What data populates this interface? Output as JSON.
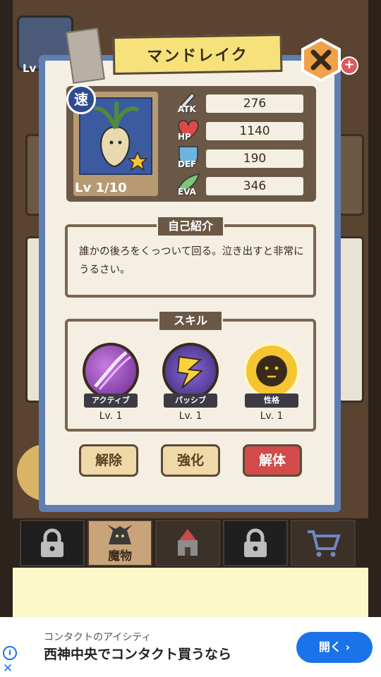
{
  "background": {
    "avatar_level": "Lv"
  },
  "dialog": {
    "title": "マンドレイク",
    "speed_badge": "速",
    "level": "Lv 1/10",
    "stats": [
      {
        "label": "ATK",
        "value": "276",
        "icon": "sword-icon"
      },
      {
        "label": "HP",
        "value": "1140",
        "icon": "heart-icon"
      },
      {
        "label": "DEF",
        "value": "190",
        "icon": "shield-icon"
      },
      {
        "label": "EVA",
        "value": "346",
        "icon": "wind-icon"
      }
    ],
    "intro_heading": "自己紹介",
    "intro_text": "誰かの後ろをくっついて回る。泣き出すと非常にうるさい。",
    "skill_heading": "スキル",
    "skills": [
      {
        "tag": "アクティブ",
        "level": "Lv. 1"
      },
      {
        "tag": "パッシブ",
        "level": "Lv. 1"
      },
      {
        "tag": "性格",
        "level": "Lv. 1"
      }
    ],
    "buttons": {
      "release": "解除",
      "strengthen": "強化",
      "dismantle": "解体"
    }
  },
  "bottom_nav": {
    "monster_label": "魔物"
  },
  "ad": {
    "subtitle": "コンタクトのアイシティ",
    "title": "西神中央でコンタクト買うなら",
    "button": "開く"
  }
}
